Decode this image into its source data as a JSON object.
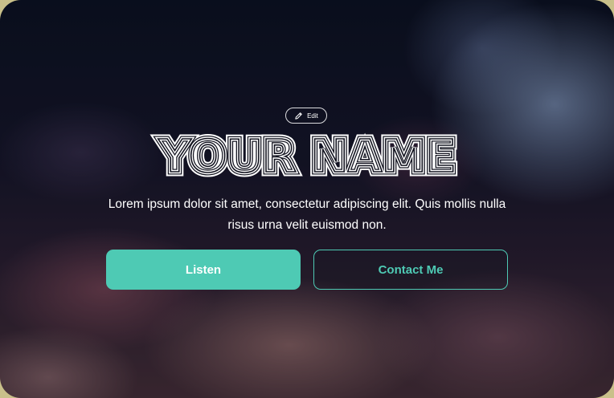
{
  "hero": {
    "edit_label": "Edit",
    "title": "YOUR NAME",
    "description": "Lorem ipsum dolor sit amet, consectetur adipiscing elit. Quis mollis nulla risus urna velit euismod non.",
    "primary_button": "Listen",
    "secondary_button": "Contact Me"
  },
  "icons": {
    "edit": "pencil-icon"
  },
  "colors": {
    "accent": "#4ecab4",
    "text": "#ffffff",
    "background_dark": "#0b1020"
  }
}
